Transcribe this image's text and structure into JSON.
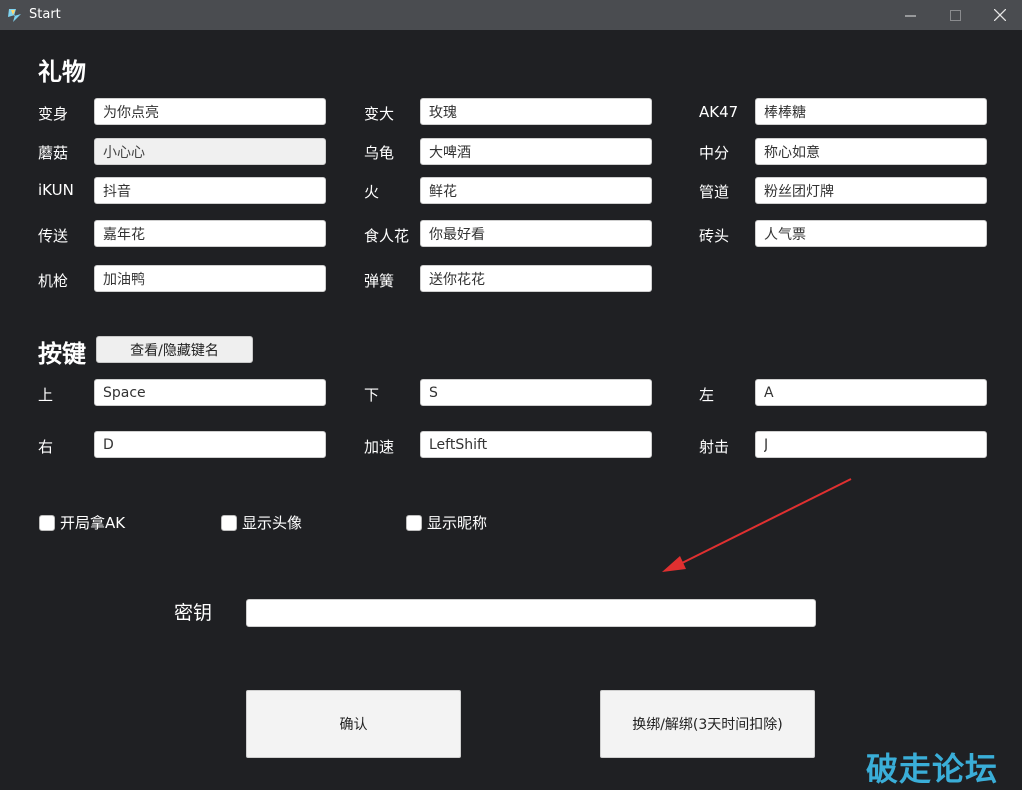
{
  "window": {
    "title": "Start"
  },
  "sections": {
    "gifts": "礼物",
    "keys": "按键"
  },
  "gifts": [
    {
      "label": "变身",
      "value": "为你点亮"
    },
    {
      "label": "变大",
      "value": "玫瑰"
    },
    {
      "label": "AK47",
      "value": "棒棒糖"
    },
    {
      "label": "蘑菇",
      "value": "小心心"
    },
    {
      "label": "乌龟",
      "value": "大啤酒"
    },
    {
      "label": "中分",
      "value": "称心如意"
    },
    {
      "label": "iKUN",
      "value": "抖音"
    },
    {
      "label": "火",
      "value": "鲜花"
    },
    {
      "label": "管道",
      "value": "粉丝团灯牌"
    },
    {
      "label": "传送",
      "value": "嘉年花"
    },
    {
      "label": "食人花",
      "value": "你最好看"
    },
    {
      "label": "砖头",
      "value": "人气票"
    },
    {
      "label": "机枪",
      "value": "加油鸭"
    },
    {
      "label": "弹簧",
      "value": "送你花花"
    }
  ],
  "toggle_key_names": "查看/隐藏键名",
  "keys": [
    {
      "label": "上",
      "value": "Space"
    },
    {
      "label": "下",
      "value": "S"
    },
    {
      "label": "左",
      "value": "A"
    },
    {
      "label": "右",
      "value": "D"
    },
    {
      "label": "加速",
      "value": "LeftShift"
    },
    {
      "label": "射击",
      "value": "J"
    }
  ],
  "options": [
    {
      "label": "开局拿AK",
      "checked": false
    },
    {
      "label": "显示头像",
      "checked": false
    },
    {
      "label": "显示昵称",
      "checked": false
    }
  ],
  "license": {
    "label": "密钥",
    "value": ""
  },
  "buttons": {
    "confirm": "确认",
    "unbind": "换绑/解绑(3天时间扣除)"
  },
  "watermark": "破走论坛",
  "colors": {
    "background": "#1f2023",
    "titlebar": "#4a4c50",
    "arrow": "#e03030",
    "watermark": "#3aaed8"
  }
}
